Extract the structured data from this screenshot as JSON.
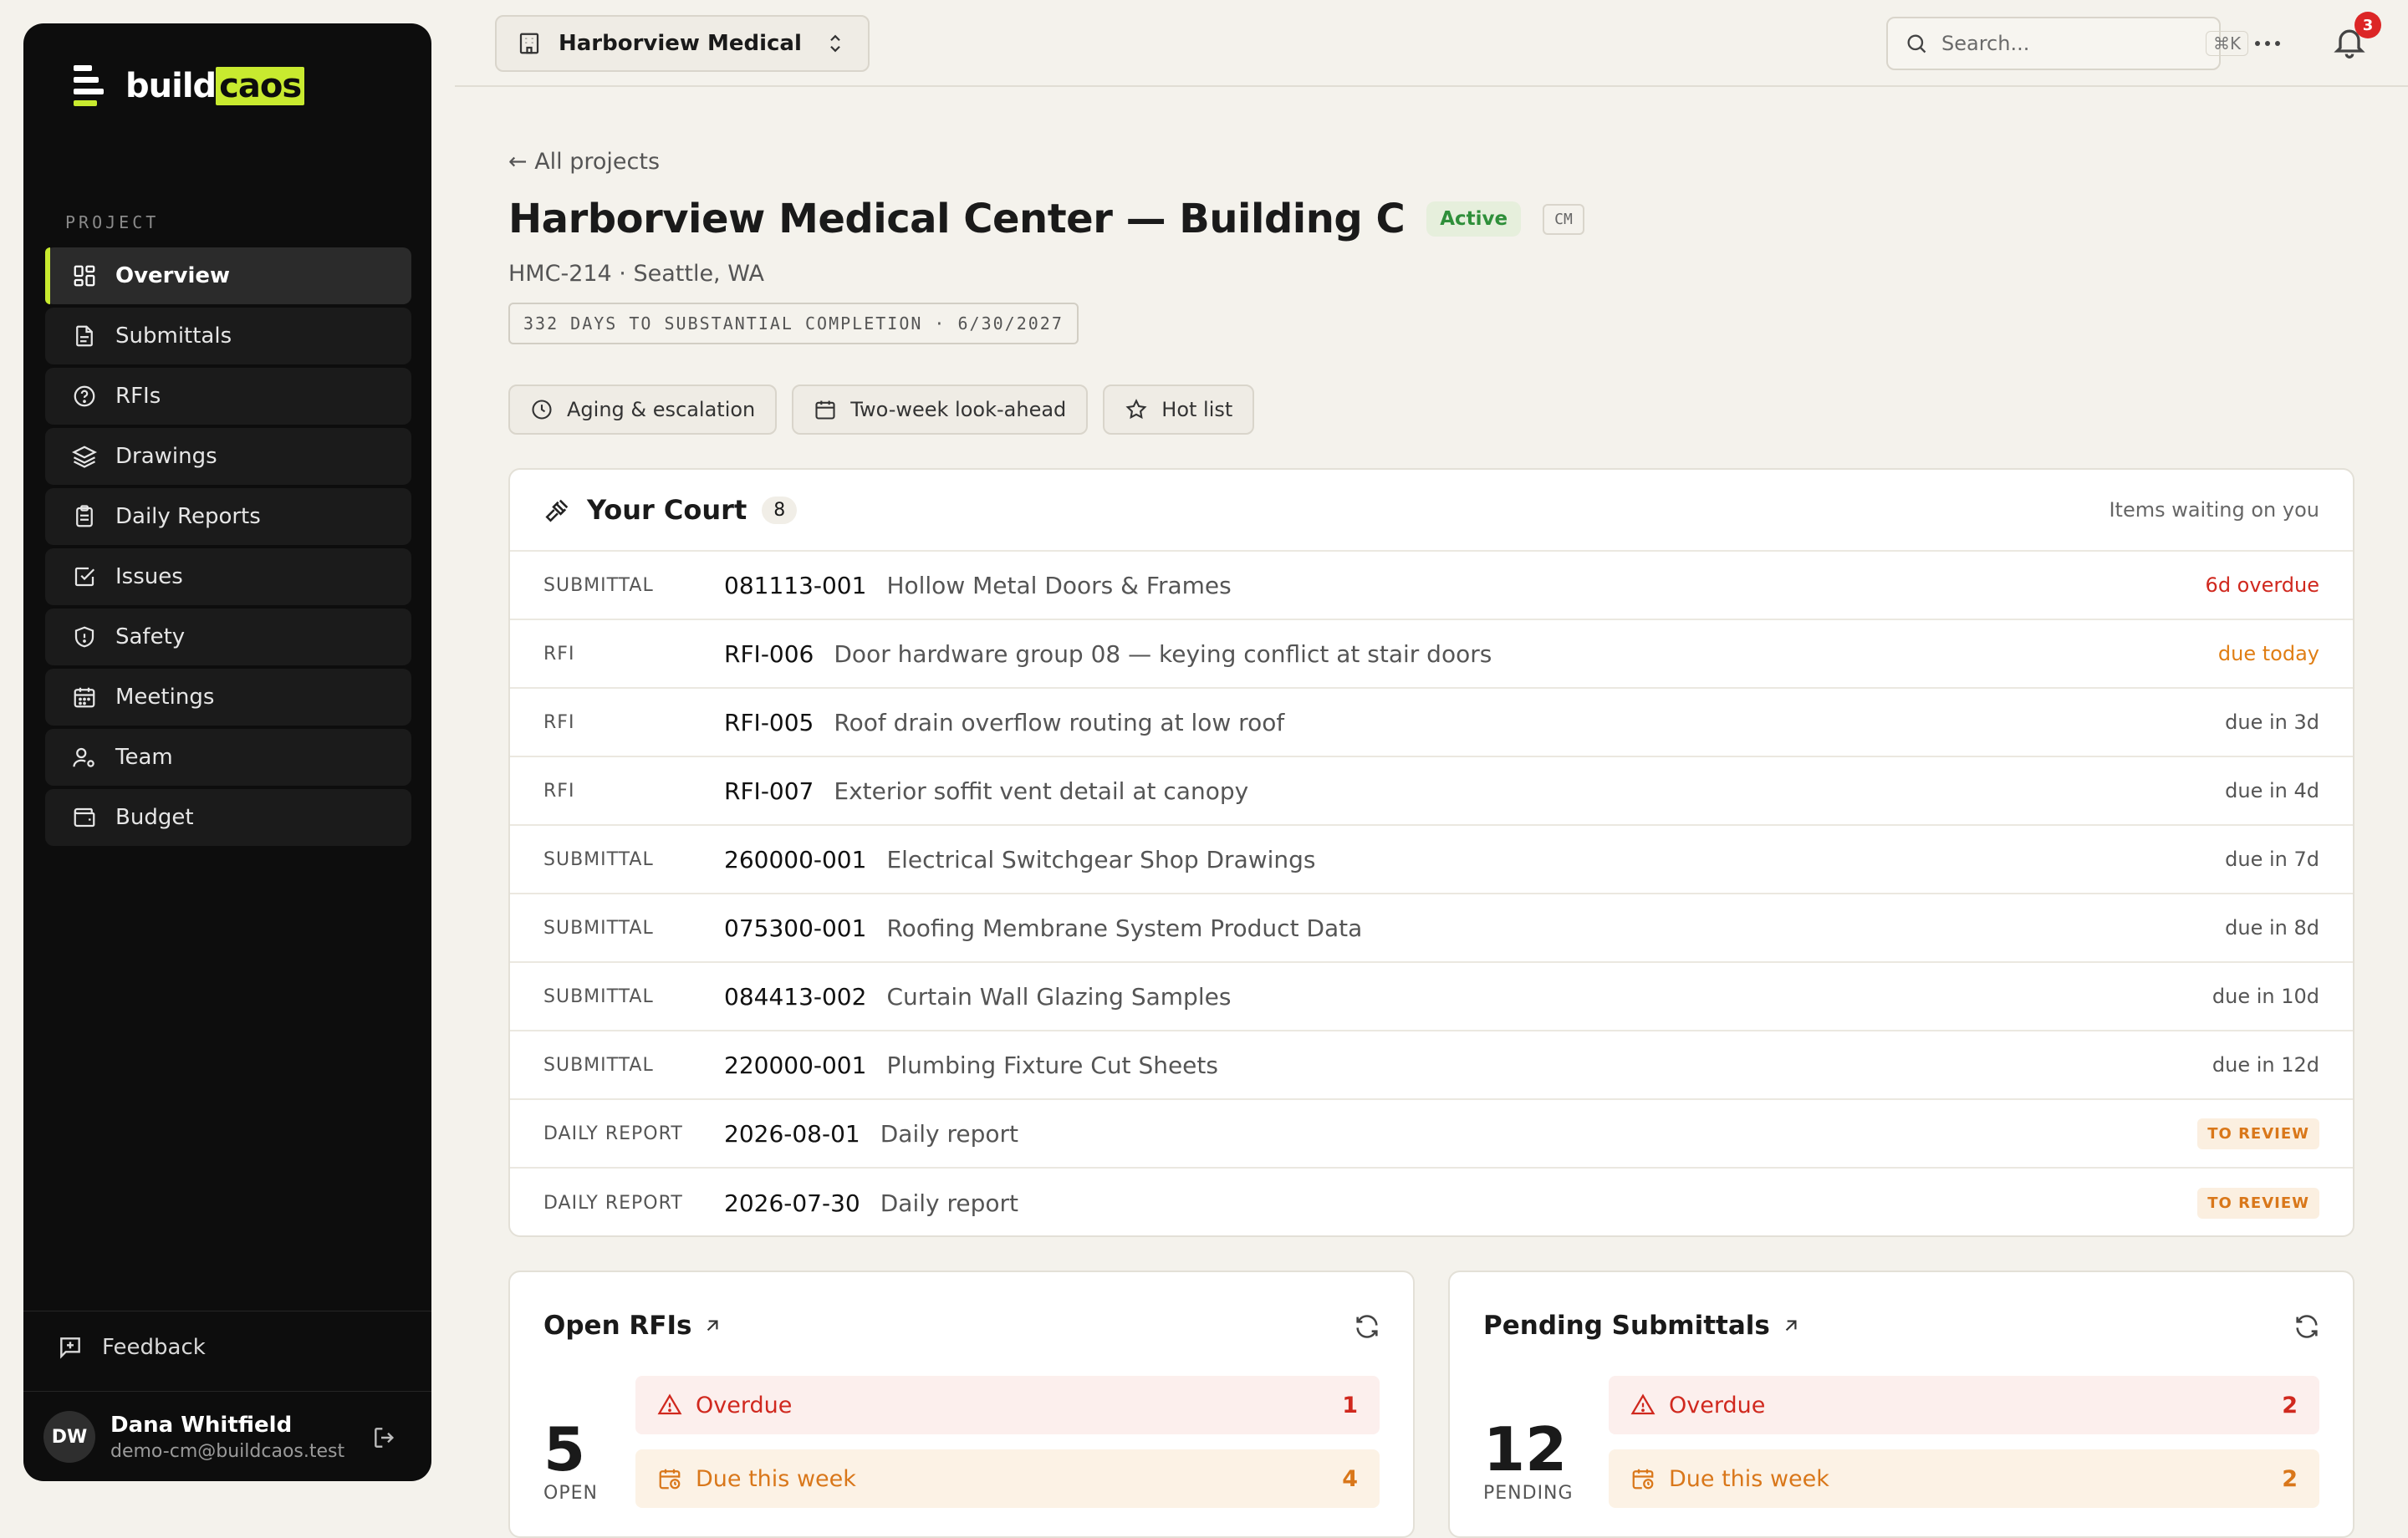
{
  "sidebar": {
    "logo": {
      "part1": "build",
      "part2": "caos"
    },
    "section_label": "PROJECT",
    "items": [
      {
        "label": "Overview",
        "icon": "grid-icon",
        "active": true
      },
      {
        "label": "Submittals",
        "icon": "document-icon",
        "active": false
      },
      {
        "label": "RFIs",
        "icon": "question-circle-icon",
        "active": false
      },
      {
        "label": "Drawings",
        "icon": "layers-icon",
        "active": false
      },
      {
        "label": "Daily Reports",
        "icon": "clipboard-icon",
        "active": false
      },
      {
        "label": "Issues",
        "icon": "check-square-icon",
        "active": false
      },
      {
        "label": "Safety",
        "icon": "shield-icon",
        "active": false
      },
      {
        "label": "Meetings",
        "icon": "calendar-icon",
        "active": false
      },
      {
        "label": "Team",
        "icon": "user-gear-icon",
        "active": false
      },
      {
        "label": "Budget",
        "icon": "wallet-icon",
        "active": false
      }
    ],
    "feedback_label": "Feedback",
    "user": {
      "initials": "DW",
      "name": "Dana Whitfield",
      "email": "demo-cm@buildcaos.test"
    }
  },
  "topbar": {
    "project_label": "Harborview Medical C...",
    "search_placeholder": "Search...",
    "search_shortcut": "⌘K",
    "notifications_count": "3"
  },
  "header": {
    "back_label": "← All projects",
    "title": "Harborview Medical Center — Building C",
    "status": "Active",
    "role": "CM",
    "subtitle": "HMC-214 · Seattle, WA",
    "countdown": "332 DAYS TO SUBSTANTIAL COMPLETION · 6/30/2027"
  },
  "quick_links": [
    {
      "label": "Aging & escalation",
      "icon": "clock-icon"
    },
    {
      "label": "Two-week look-ahead",
      "icon": "calendar-icon"
    },
    {
      "label": "Hot list",
      "icon": "star-icon"
    }
  ],
  "court": {
    "title": "Your Court",
    "count": "8",
    "hint": "Items waiting on you",
    "rows": [
      {
        "type": "SUBMITTAL",
        "id": "081113-001",
        "desc": "Hollow Metal Doors & Frames",
        "due": "6d overdue",
        "tone": "red"
      },
      {
        "type": "RFI",
        "id": "RFI-006",
        "desc": "Door hardware group 08 — keying conflict at stair doors",
        "due": "due today",
        "tone": "orange"
      },
      {
        "type": "RFI",
        "id": "RFI-005",
        "desc": "Roof drain overflow routing at low roof",
        "due": "due in 3d",
        "tone": "normal"
      },
      {
        "type": "RFI",
        "id": "RFI-007",
        "desc": "Exterior soffit vent detail at canopy",
        "due": "due in 4d",
        "tone": "normal"
      },
      {
        "type": "SUBMITTAL",
        "id": "260000-001",
        "desc": "Electrical Switchgear Shop Drawings",
        "due": "due in 7d",
        "tone": "normal"
      },
      {
        "type": "SUBMITTAL",
        "id": "075300-001",
        "desc": "Roofing Membrane System Product Data",
        "due": "due in 8d",
        "tone": "normal"
      },
      {
        "type": "SUBMITTAL",
        "id": "084413-002",
        "desc": "Curtain Wall Glazing Samples",
        "due": "due in 10d",
        "tone": "normal"
      },
      {
        "type": "SUBMITTAL",
        "id": "220000-001",
        "desc": "Plumbing Fixture Cut Sheets",
        "due": "due in 12d",
        "tone": "normal"
      },
      {
        "type": "DAILY REPORT",
        "id": "2026-08-01",
        "desc": "Daily report",
        "due": "TO REVIEW",
        "tone": "review"
      },
      {
        "type": "DAILY REPORT",
        "id": "2026-07-30",
        "desc": "Daily report",
        "due": "TO REVIEW",
        "tone": "review"
      }
    ]
  },
  "open_rfis": {
    "title": "Open RFIs",
    "total": "5",
    "total_label": "OPEN",
    "overdue_label": "Overdue",
    "overdue": "1",
    "week_label": "Due this week",
    "week": "4"
  },
  "pending_submittals": {
    "title": "Pending Submittals",
    "total": "12",
    "total_label": "PENDING",
    "overdue_label": "Overdue",
    "overdue": "2",
    "week_label": "Due this week",
    "week": "2"
  }
}
